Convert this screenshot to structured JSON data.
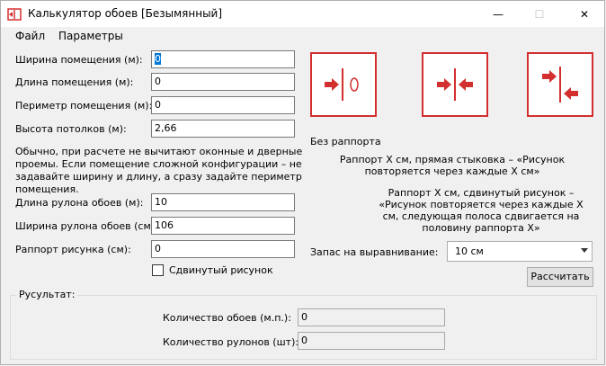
{
  "window": {
    "title": "Калькулятор обоев [Безымянный]",
    "minimize_glyph": "—",
    "maximize_glyph": "☐",
    "close_glyph": "✕"
  },
  "menu": {
    "file": "Файл",
    "params": "Параметры"
  },
  "room": {
    "width_label": "Ширина помещения (м):",
    "width_value": "0",
    "length_label": "Длина помещения (м):",
    "length_value": "0",
    "perimeter_label": "Периметр помещения (м):",
    "perimeter_value": "0",
    "height_label": "Высота потолков (м):",
    "height_value": "2,66"
  },
  "note": "Обычно, при расчете не вычитают оконные и дверные проемы. Если помещение сложной конфигурации – не задавайте ширину и длину, а сразу задайте периметр помещения.",
  "roll": {
    "length_label": "Длина рулона обоев (м):",
    "length_value": "10",
    "width_label": "Ширина рулона обоев (см):",
    "width_value": "106",
    "repeat_label": "Раппорт рисунка (см):",
    "repeat_value": "0",
    "shifted_label": "Сдвинутый рисунок"
  },
  "pattern": {
    "no_repeat": "Без раппорта",
    "straight": "Раппорт X см, прямая стыковка – «Рисунок повторяется через каждые X см»",
    "shifted": "Раппорт X см, сдвинутый рисунок – «Рисунок повторяется через каждые X см, следующая полоса сдвигается на половину раппорта X»"
  },
  "reserve": {
    "label": "Запас на выравнивание:",
    "value": "10 см"
  },
  "calc_button": "Рассчитать",
  "result": {
    "title": "Русультат:",
    "meters_label": "Количество обоев (м.п.):",
    "meters_value": "0",
    "rolls_label": "Количество рулонов (шт):",
    "rolls_value": "0"
  },
  "colors": {
    "accent": "#d32f2f",
    "selection": "#0078d7"
  },
  "icons": [
    "app-icon",
    "arrow-to-line-icon",
    "arrows-converge-icon",
    "arrows-shifted-icon"
  ]
}
